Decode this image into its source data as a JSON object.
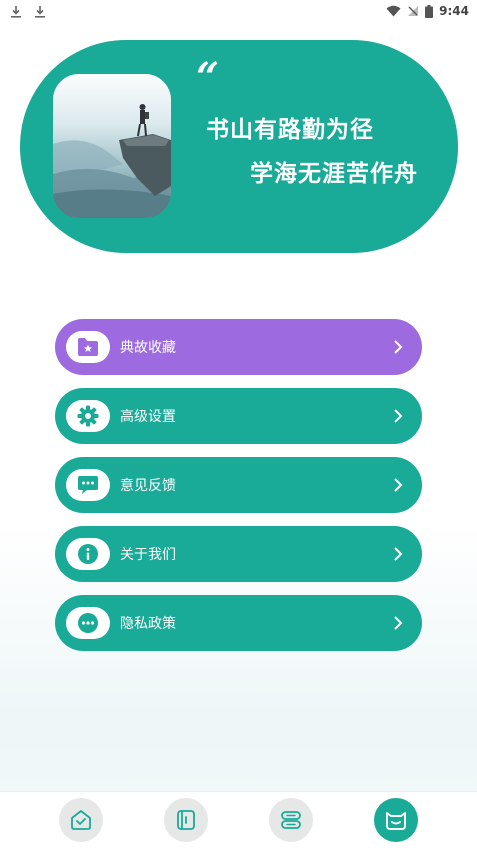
{
  "status_bar": {
    "time": "9:44",
    "left_icons": [
      "download-icon",
      "download-icon"
    ],
    "right_icons": [
      "wifi-icon",
      "no-signal-icon",
      "battery-icon"
    ]
  },
  "banner": {
    "quote_mark": "“",
    "slogan_line1": "书山有路勤为径",
    "slogan_line2": "学海无涯苦作舟",
    "image": "mountain-hiker-photo"
  },
  "menu": {
    "items": [
      {
        "label": "典故收藏",
        "icon": "folder-star-icon",
        "color": "#9e6ae0"
      },
      {
        "label": "高级设置",
        "icon": "gear-icon",
        "color": "#19aa98"
      },
      {
        "label": "意见反馈",
        "icon": "chat-bubble-icon",
        "color": "#19aa98"
      },
      {
        "label": "关于我们",
        "icon": "info-icon",
        "color": "#19aa98"
      },
      {
        "label": "隐私政策",
        "icon": "more-dots-icon",
        "color": "#19aa98"
      }
    ]
  },
  "bottom_nav": {
    "items": [
      {
        "icon": "home-check-icon",
        "active": false
      },
      {
        "icon": "book-icon",
        "active": false
      },
      {
        "icon": "list-icon",
        "active": false
      },
      {
        "icon": "profile-icon",
        "active": true
      }
    ]
  },
  "colors": {
    "accent": "#19aa98",
    "purple": "#9e6ae0",
    "nav_inactive": "#e6e8e8"
  }
}
